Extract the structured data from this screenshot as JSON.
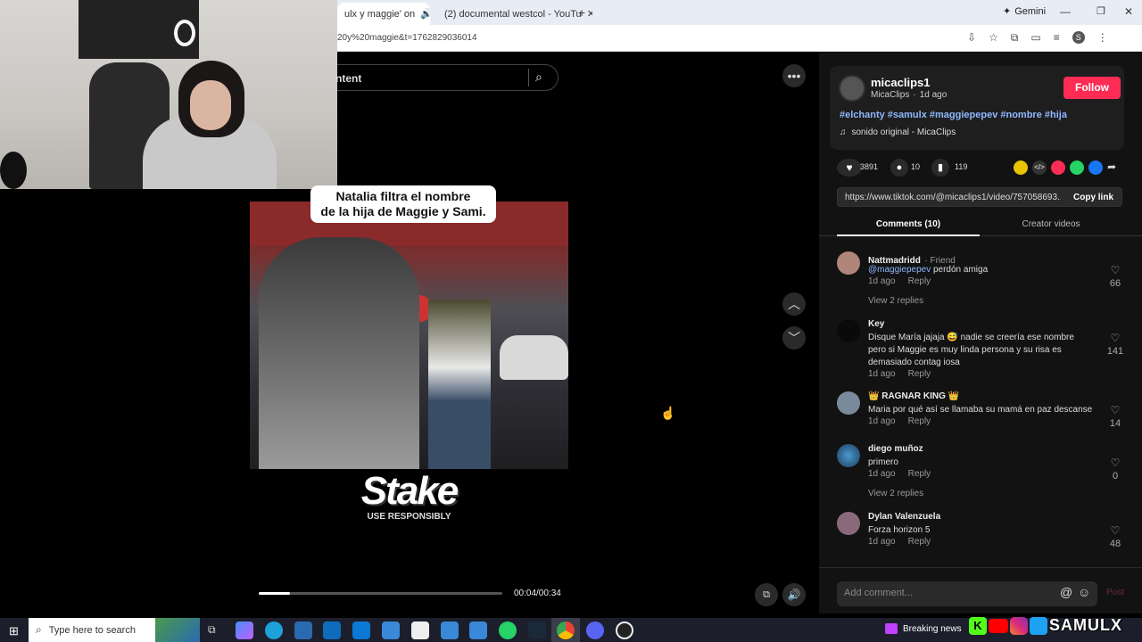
{
  "browser": {
    "tabs": [
      {
        "label": "ulx y maggie' on",
        "active": true
      },
      {
        "label": "(2) documental westcol - YouTu",
        "active": false
      }
    ],
    "gemini_label": "Gemini",
    "url": "20y%20maggie&t=1762829036014"
  },
  "search": {
    "placeholder": "ntent"
  },
  "video": {
    "caption_line1": "Natalia filtra el nombre",
    "caption_line2": "de la hija de Maggie y Sami.",
    "logo_text": "Stake",
    "logo_sub": "USE RESPONSIBLY",
    "time": "00:04/00:34",
    "progress": 0.13
  },
  "author": {
    "username": "micaclips1",
    "display": "MicaClips",
    "age": "1d ago",
    "follow_label": "Follow",
    "hashtags": "#elchanty #samulx #maggiepepev #nombre #hija",
    "sound": "sonido original - MicaClips"
  },
  "stats": {
    "likes": "3891",
    "comments": "10",
    "saves": "119"
  },
  "share": {
    "link": "https://www.tiktok.com/@micaclips1/video/757058693...",
    "copy_label": "Copy link"
  },
  "tabs": {
    "comments": "Comments (10)",
    "creator": "Creator videos"
  },
  "comments": [
    {
      "name": "Nattmadridd",
      "badge": "· Friend",
      "mention": "@maggiepepev",
      "text": " perdón amiga",
      "time": "1d ago",
      "reply": "Reply",
      "likes": "66",
      "replies": "View 2 replies"
    },
    {
      "name": "Key",
      "text": "Disque María jajaja 😅 nadie se creería ese nombre pero si Maggie es muy linda persona y su risa es demasiado contag iosa",
      "time": "1d ago",
      "reply": "Reply",
      "likes": "141"
    },
    {
      "name": "👑 RAGNAR KING 👑",
      "text": "Maria por qué así se llamaba su mamá en paz descanse",
      "time": "1d ago",
      "reply": "Reply",
      "likes": "14"
    },
    {
      "name": "diego muñoz",
      "text": "primero",
      "time": "1d ago",
      "reply": "Reply",
      "likes": "0",
      "replies": "View 2 replies"
    },
    {
      "name": "Dylan Valenzuela",
      "text": "Forza horizon 5",
      "time": "1d ago",
      "reply": "Reply",
      "likes": "48"
    }
  ],
  "add_comment": {
    "placeholder": "Add comment...",
    "post_label": "Post"
  },
  "taskbar": {
    "search_placeholder": "Type here to search",
    "news": "Breaking news",
    "brand": "SAMULX"
  },
  "colors": {
    "follow": "#fe2c55",
    "hashtag": "#8fb8ff",
    "mention": "#8fb8ff"
  }
}
